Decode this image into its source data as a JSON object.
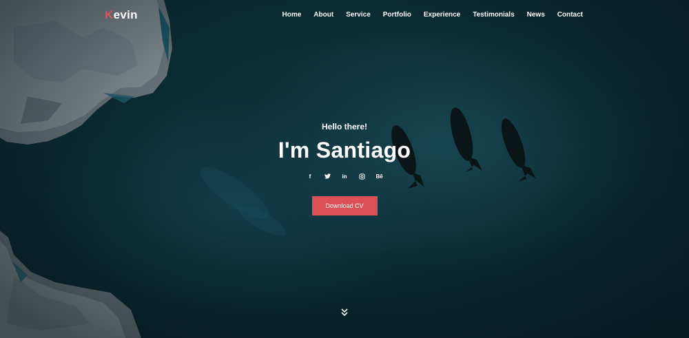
{
  "brand": {
    "first_letter": "K",
    "rest": "evin"
  },
  "nav": {
    "items": [
      {
        "label": "Home"
      },
      {
        "label": "About"
      },
      {
        "label": "Service"
      },
      {
        "label": "Portfolio"
      },
      {
        "label": "Experience"
      },
      {
        "label": "Testimonials"
      },
      {
        "label": "News"
      },
      {
        "label": "Contact"
      }
    ]
  },
  "hero": {
    "greeting": "Hello there!",
    "headline": "I'm Santiago",
    "cta_label": "Download CV"
  },
  "socials": {
    "facebook": "f",
    "twitter": "🐦",
    "linkedin": "in",
    "instagram": "◎",
    "behance": "Bē"
  },
  "colors": {
    "accent": "#e0525b",
    "button": "#dd5156",
    "ocean": "#0d2f38"
  },
  "icons": {
    "scroll": "double-chevron-down-icon"
  }
}
